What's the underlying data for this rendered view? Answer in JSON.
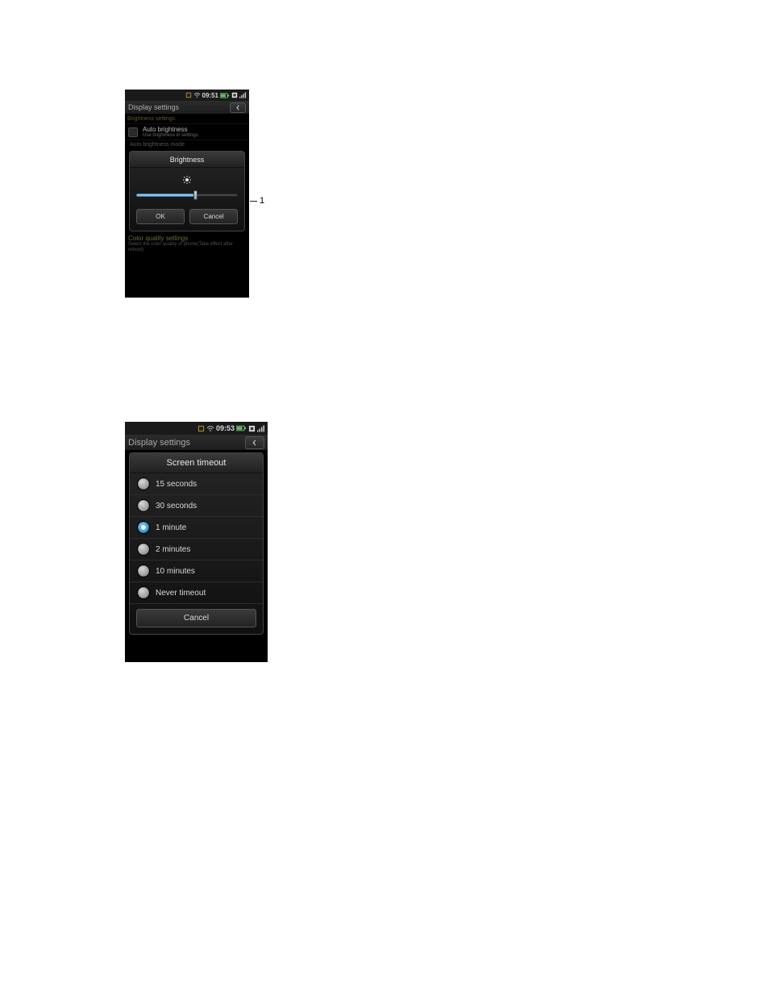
{
  "phone1": {
    "status": {
      "time": "09:51"
    },
    "header": {
      "title": "Display settings"
    },
    "section_label": "Brightness settings",
    "auto_brightness": {
      "title": "Auto brightness",
      "subtitle": "Use brightness in settings"
    },
    "dim_row": "Auto brightness mode",
    "dialog": {
      "title": "Brightness",
      "ok": "OK",
      "cancel": "Cancel"
    },
    "slider_percent": 58,
    "annotation": "1",
    "color_quality": {
      "title": "Color quality settings",
      "desc": "Select the color quality of phone(Take effect after reboot)"
    }
  },
  "phone2": {
    "status": {
      "time": "09:53"
    },
    "header": {
      "title": "Display settings"
    },
    "dialog": {
      "title": "Screen timeout",
      "options": [
        {
          "label": "15 seconds",
          "selected": false
        },
        {
          "label": "30 seconds",
          "selected": false
        },
        {
          "label": "1 minute",
          "selected": true
        },
        {
          "label": "2 minutes",
          "selected": false
        },
        {
          "label": "10 minutes",
          "selected": false
        },
        {
          "label": "Never timeout",
          "selected": false
        }
      ],
      "cancel": "Cancel"
    }
  }
}
